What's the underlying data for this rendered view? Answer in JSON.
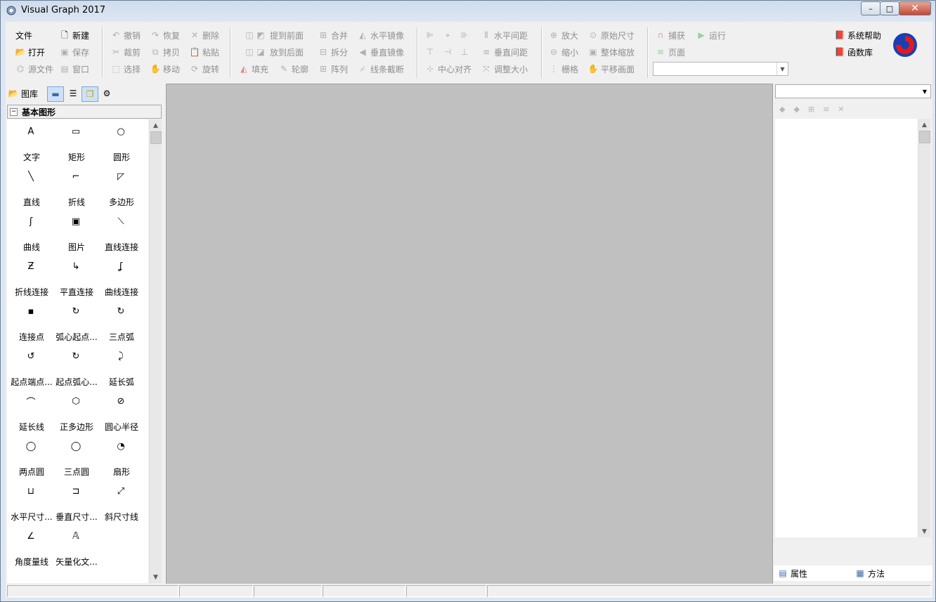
{
  "window": {
    "title": "Visual Graph 2017",
    "minimize": "–",
    "maximize": "□",
    "close": "✕"
  },
  "toolbar": {
    "file": {
      "menu": "文件",
      "new": "新建",
      "open": "打开",
      "save": "保存",
      "source": "源文件",
      "window": "窗口"
    },
    "edit": {
      "undo": "撤销",
      "redo": "恢复",
      "delete": "删除",
      "cut": "裁剪",
      "copy": "拷贝",
      "paste": "粘贴",
      "select": "选择",
      "move": "移动",
      "rotate": "旋转"
    },
    "arrange": {
      "bring_front": "提到前面",
      "send_back": "放到后面",
      "fill": "填充",
      "outline": "轮廓",
      "merge": "合并",
      "split": "拆分",
      "array": "阵列",
      "hmirror": "水平镜像",
      "vmirror": "垂直镜像",
      "line_cut": "线条截断"
    },
    "align": {
      "h_spacing": "水平间距",
      "v_spacing": "垂直间距",
      "center_align": "中心对齐",
      "resize": "调整大小"
    },
    "view": {
      "zoom_in": "放大",
      "zoom_out": "缩小",
      "grid": "栅格",
      "original_size": "原始尺寸",
      "fit_all": "整体缩放",
      "pan": "平移画面"
    },
    "run": {
      "capture": "捕获",
      "run": "运行",
      "page": "页面",
      "page_value": ""
    },
    "help": {
      "system_help": "系统帮助",
      "function_lib": "函数库"
    }
  },
  "left_panel": {
    "tab_library": "图库",
    "group_title": "基本图形",
    "shapes": [
      {
        "icon": "text-icon",
        "glyph": "A",
        "label": "文字"
      },
      {
        "icon": "rectangle-icon",
        "glyph": "▭",
        "label": "矩形"
      },
      {
        "icon": "circle-icon",
        "glyph": "○",
        "label": "圆形"
      },
      {
        "icon": "line-icon",
        "glyph": "╲",
        "label": "直线"
      },
      {
        "icon": "polyline-icon",
        "glyph": "⌐",
        "label": "折线"
      },
      {
        "icon": "polygon-icon",
        "glyph": "◸",
        "label": "多边形"
      },
      {
        "icon": "curve-icon",
        "glyph": "ʃ",
        "label": "曲线"
      },
      {
        "icon": "image-icon",
        "glyph": "▣",
        "label": "图片"
      },
      {
        "icon": "line-connector-icon",
        "glyph": "⟍",
        "label": "直线连接"
      },
      {
        "icon": "polyline-connector-icon",
        "glyph": "Ƶ",
        "label": "折线连接"
      },
      {
        "icon": "orthogonal-connector-icon",
        "glyph": "↳",
        "label": "平直连接"
      },
      {
        "icon": "curve-connector-icon",
        "glyph": "ʆ",
        "label": "曲线连接"
      },
      {
        "icon": "connection-point-icon",
        "glyph": "▪",
        "label": "连接点"
      },
      {
        "icon": "arc-center-start-icon",
        "glyph": "↻",
        "label": "弧心起点..."
      },
      {
        "icon": "three-point-arc-icon",
        "glyph": "↻",
        "label": "三点弧"
      },
      {
        "icon": "start-end-arc-icon",
        "glyph": "↺",
        "label": "起点端点..."
      },
      {
        "icon": "start-center-arc-icon",
        "glyph": "↻",
        "label": "起点弧心..."
      },
      {
        "icon": "extend-arc-icon",
        "glyph": "⤸",
        "label": "延长弧"
      },
      {
        "icon": "extend-line-icon",
        "glyph": "⌒",
        "label": "延长线"
      },
      {
        "icon": "regular-polygon-icon",
        "glyph": "⬡",
        "label": "正多边形"
      },
      {
        "icon": "center-radius-icon",
        "glyph": "⊘",
        "label": "圆心半径"
      },
      {
        "icon": "two-point-circle-icon",
        "glyph": "◯",
        "label": "两点圆"
      },
      {
        "icon": "three-point-circle-icon",
        "glyph": "◯",
        "label": "三点圆"
      },
      {
        "icon": "sector-icon",
        "glyph": "◔",
        "label": "扇形"
      },
      {
        "icon": "h-dimension-icon",
        "glyph": "⊔",
        "label": "水平尺寸..."
      },
      {
        "icon": "v-dimension-icon",
        "glyph": "⊐",
        "label": "垂直尺寸..."
      },
      {
        "icon": "oblique-dimension-icon",
        "glyph": "⤢",
        "label": "斜尺寸线"
      },
      {
        "icon": "angle-dimension-icon",
        "glyph": "∠",
        "label": "角度量线"
      },
      {
        "icon": "vector-text-icon",
        "glyph": "𝔸",
        "label": "矢量化文..."
      }
    ]
  },
  "right_panel": {
    "combo_value": "",
    "tab_properties": "属性",
    "tab_methods": "方法"
  },
  "colors": {
    "canvas": "#c0c0c0",
    "accent": "#7ca6d7"
  }
}
